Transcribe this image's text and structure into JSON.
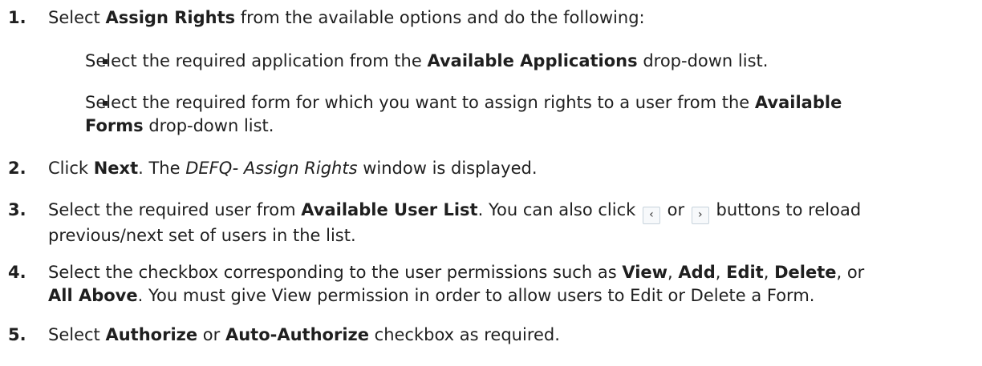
{
  "steps": [
    {
      "num": "1.",
      "a": "Select ",
      "b1": "Assign Rights",
      "c": " from the available options and do the following:"
    },
    {
      "num": "2.",
      "a": "Click ",
      "b1": "Next",
      "c": ". The ",
      "i1": "DEFQ- Assign Rights",
      "d": " window is displayed."
    },
    {
      "num": "3.",
      "a": "Select the required user from ",
      "b1": "Available User List",
      "c": ". You can also click ",
      "or": "or",
      "d": "buttons to reload",
      "line2": "previous/next set of users in the list."
    },
    {
      "num": "4.",
      "a": "Select the checkbox corresponding to the user permissions such as ",
      "b1": "View",
      "s1": ", ",
      "b2": "Add",
      "s2": ", ",
      "b3": "Edit",
      "s3": ", ",
      "b4": "Delete",
      "s4": ", or",
      "b5": "All Above",
      "c": ". You must give View permission in order to allow users to Edit or Delete a Form."
    },
    {
      "num": "5.",
      "a": "Select ",
      "b1": "Authorize",
      "c": " or ",
      "b2": "Auto-Authorize",
      "d": " checkbox as required."
    }
  ],
  "bullets": [
    {
      "a": "Select the required application from the ",
      "b1": "Available Applications",
      "c": " drop-down list."
    },
    {
      "a": "Select the required form for which you want to assign rights to a user from the ",
      "b1": "Available",
      "b2": "Forms",
      "c": " drop-down list."
    }
  ],
  "icons": {
    "prev": "chevron-left-icon",
    "next": "chevron-right-icon"
  }
}
